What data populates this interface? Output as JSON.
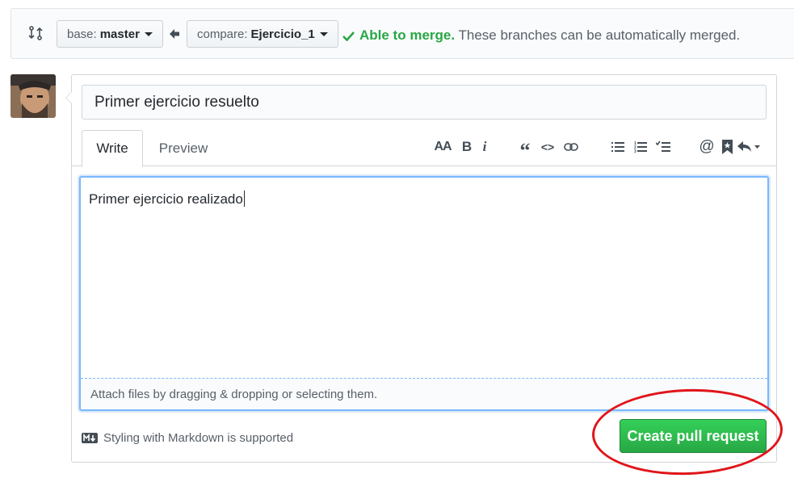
{
  "compare_bar": {
    "base_prefix": "base:",
    "base_branch": "master",
    "compare_prefix": "compare:",
    "compare_branch": "Ejercicio_1",
    "merge_ok": "Able to merge.",
    "merge_message": " These branches can be automatically merged."
  },
  "form": {
    "title_value": "Primer ejercicio resuelto",
    "tabs": [
      {
        "label": "Write",
        "active": true
      },
      {
        "label": "Preview",
        "active": false
      }
    ],
    "body_value": "Primer ejercicio realizado",
    "attach_hint": "Attach files by dragging & dropping or selecting them.",
    "markdown_hint": "Styling with Markdown is supported",
    "submit_label": "Create pull request"
  },
  "toolbar": {
    "heading": "AA",
    "bold": "B",
    "italic": "i",
    "quote": "“",
    "code": "<>",
    "mention": "@"
  },
  "colors": {
    "accent_green": "#28a745",
    "focus_blue": "#79b8ff",
    "annotation_red": "#e0151a"
  }
}
